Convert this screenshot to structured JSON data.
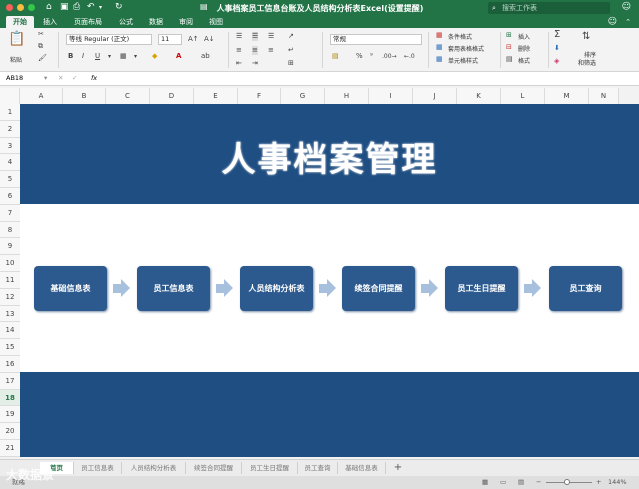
{
  "window": {
    "title": "人事档案员工信息台账及人员结构分析表Excel(设置提醒)",
    "search_placeholder": "搜索工作表"
  },
  "tabs": [
    "开始",
    "插入",
    "页面布局",
    "公式",
    "数据",
    "审阅",
    "视图"
  ],
  "active_tab": "开始",
  "ribbon": {
    "paste_label": "粘贴",
    "font_name": "等线 Regular (正文)",
    "font_size": "11",
    "number_format": "常规",
    "percent_symbol": "%",
    "styles": [
      "条件格式",
      "套用表格格式",
      "单元格样式"
    ],
    "cells": [
      "插入",
      "删除",
      "格式"
    ],
    "sort_label": "排序\n和筛选",
    "sort_line1": "排序",
    "sort_line2": "和筛选"
  },
  "formula_bar": {
    "name_box": "AB18",
    "fx": "fx",
    "value": ""
  },
  "columns": [
    "A",
    "B",
    "C",
    "D",
    "E",
    "F",
    "G",
    "H",
    "I",
    "J",
    "K",
    "L",
    "M",
    "N"
  ],
  "rows": [
    "1",
    "2",
    "3",
    "4",
    "5",
    "6",
    "7",
    "8",
    "9",
    "10",
    "11",
    "12",
    "13",
    "14",
    "15",
    "16",
    "17",
    "18",
    "19",
    "20",
    "21"
  ],
  "selected_row": "18",
  "sheet": {
    "title": "人事档案管理",
    "flow": [
      "基础信息表",
      "员工信息表",
      "人员结构分析表",
      "续签合同提醒",
      "员工生日提醒",
      "员工查询"
    ]
  },
  "sheet_tabs": [
    "首页",
    "员工信息表",
    "人员结构分析表",
    "续签合同提醒",
    "员工生日提醒",
    "员工查询",
    "基础信息表"
  ],
  "active_sheet": "首页",
  "add_sheet": "+",
  "status": {
    "ready": "就绪",
    "zoom": "144%"
  },
  "watermark": "大数据景"
}
